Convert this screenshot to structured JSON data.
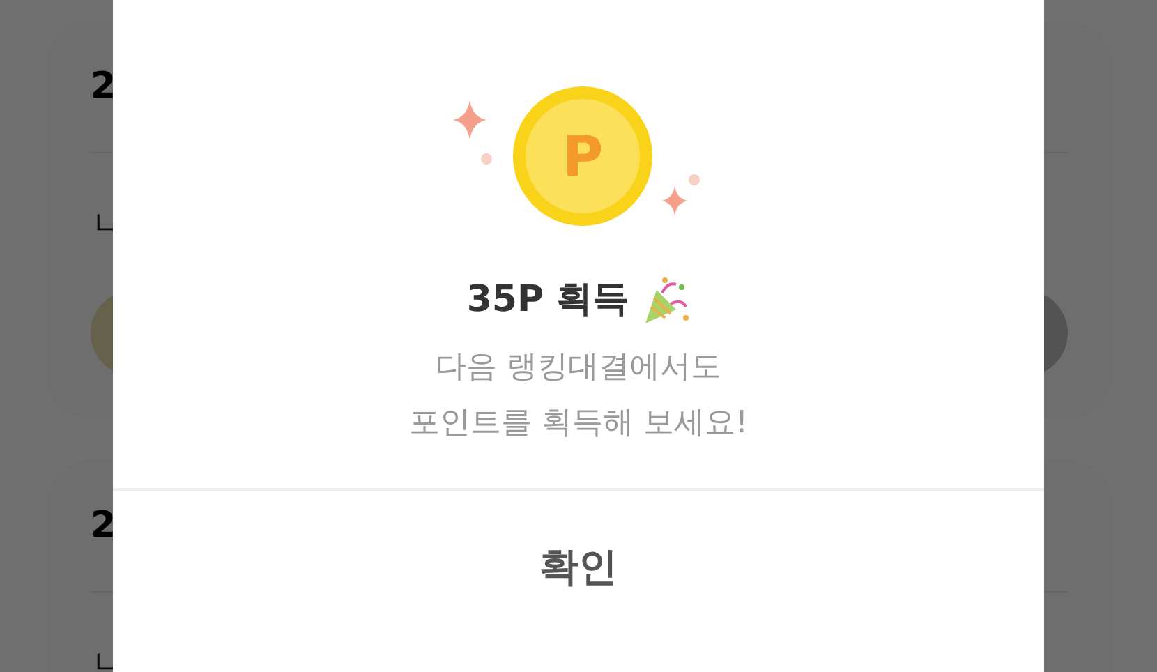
{
  "background_cards": [
    {
      "heading": "2",
      "label": "ㄴ"
    },
    {
      "heading": "2",
      "label": "ㄴ"
    }
  ],
  "dialog": {
    "coin_symbol": "P",
    "title": "35P 획득",
    "message": [
      "다음 랭킹대결에서도",
      "포인트를 획득해 보세요!"
    ],
    "confirm_button": "확인"
  }
}
